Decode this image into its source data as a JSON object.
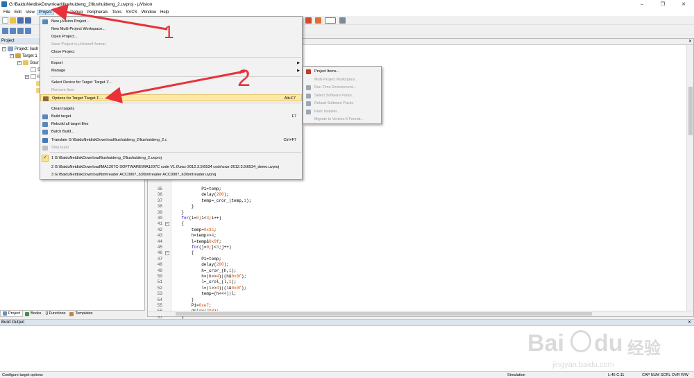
{
  "window": {
    "title": "G:\\BaiduNetdiskDownload\\liushuideng_2\\liushuideng_2.uvproj - µVision",
    "controls": [
      "–",
      "❐",
      "✕"
    ]
  },
  "menubar": [
    "File",
    "Edit",
    "View",
    "Project",
    "Flash",
    "Debug",
    "Peripherals",
    "Tools",
    "SVCS",
    "Window",
    "Help"
  ],
  "project_panel": {
    "title": "Project",
    "tree": [
      "Project: liush",
      "Target 1",
      "Sour",
      "S",
      "li"
    ],
    "tabs": [
      "Project",
      "Books",
      "{} Functions",
      "Templates"
    ]
  },
  "project_menu": {
    "items": [
      {
        "label": "New µVision Project...",
        "shortcut": "",
        "icon": "new-project-icon",
        "disabled": false
      },
      {
        "label": "New Multi-Project Workspace...",
        "shortcut": "",
        "icon": "",
        "disabled": false
      },
      {
        "label": "Open Project...",
        "shortcut": "",
        "icon": "",
        "disabled": false
      },
      {
        "label": "Save Project in µVision4 format",
        "shortcut": "",
        "icon": "",
        "disabled": true
      },
      {
        "label": "Close Project",
        "shortcut": "",
        "icon": "",
        "disabled": false
      },
      {
        "label": "Export",
        "shortcut": "",
        "icon": "",
        "disabled": false,
        "submenu": true
      },
      {
        "label": "Manage",
        "shortcut": "",
        "icon": "",
        "disabled": false,
        "submenu": true
      },
      {
        "label": "Select Device for Target 'Target 1'...",
        "shortcut": "",
        "icon": "",
        "disabled": false
      },
      {
        "label": "Remove Item",
        "shortcut": "",
        "icon": "",
        "disabled": true
      },
      {
        "label": "Options for Target 'Target 1'...",
        "shortcut": "Alt+F7",
        "icon": "options-wand-icon",
        "disabled": false,
        "highlighted": true
      },
      {
        "label": "Clean targets",
        "shortcut": "",
        "icon": "",
        "disabled": false
      },
      {
        "label": "Build target",
        "shortcut": "F7",
        "icon": "build-icon",
        "disabled": false
      },
      {
        "label": "Rebuild all target files",
        "shortcut": "",
        "icon": "rebuild-icon",
        "disabled": false
      },
      {
        "label": "Batch Build...",
        "shortcut": "",
        "icon": "batch-build-icon",
        "disabled": false
      },
      {
        "label": "Translate G:\\BaiduNetdiskDownload\\liushuideng_2\\liushuideng_2.c",
        "shortcut": "Ctrl+F7",
        "icon": "translate-icon",
        "disabled": false
      },
      {
        "label": "Stop build",
        "shortcut": "",
        "icon": "stop-build-icon",
        "disabled": true
      },
      {
        "label": "1 G:\\BaiduNetdiskDownload\\liushuideng_2\\liushuideng_2.uvproj",
        "shortcut": "",
        "icon": "",
        "disabled": false,
        "checked": true
      },
      {
        "label": "2 G:\\BaiduNetdiskDownload\\MA1207C-SOFTWARE\\MA1207C code V1.0\\zwz-2012.3.5\\6534 code\\zwz-2012.3.5\\6534_demo.uvproj",
        "shortcut": "",
        "icon": "",
        "disabled": false
      },
      {
        "label": "3 G:\\BaiduNetdiskDownload\\bmtreader ACC0907_63\\bmtreader ACC0907_63\\bmtreader.uvproj",
        "shortcut": "",
        "icon": "",
        "disabled": false
      }
    ]
  },
  "manage_submenu": [
    {
      "label": "Project Items...",
      "disabled": false,
      "icon": "project-items-icon"
    },
    {
      "label": "Multi-Project Workspace...",
      "disabled": true,
      "icon": ""
    },
    {
      "label": "Run-Time Environment...",
      "disabled": true,
      "icon": "runtime-env-icon"
    },
    {
      "label": "Select Software Packs...",
      "disabled": true,
      "icon": "packs-icon"
    },
    {
      "label": "Reload Software Packs",
      "disabled": true,
      "icon": "reload-icon"
    },
    {
      "label": "Pack Installer...",
      "disabled": true,
      "icon": "pack-installer-icon"
    },
    {
      "label": "Migrate to Version 5 Format...",
      "disabled": true,
      "icon": ""
    }
  ],
  "editor": {
    "lines": [
      {
        "n": "35",
        "fold": false,
        "code": "            P1=temp;"
      },
      {
        "n": "36",
        "fold": false,
        "code": "            delay(200);"
      },
      {
        "n": "37",
        "fold": false,
        "code": "            temp=_cror_(temp,1);"
      },
      {
        "n": "38",
        "fold": false,
        "code": "        }"
      },
      {
        "n": "39",
        "fold": false,
        "code": "    }"
      },
      {
        "n": "40",
        "fold": false,
        "code": "    for(i=0;i<3;i++)"
      },
      {
        "n": "41",
        "fold": true,
        "code": "    {"
      },
      {
        "n": "42",
        "fold": false,
        "code": "        temp=0x3c;"
      },
      {
        "n": "43",
        "fold": false,
        "code": "        h=temp>>4;"
      },
      {
        "n": "44",
        "fold": false,
        "code": "        l=temp&0x0f;"
      },
      {
        "n": "45",
        "fold": false,
        "code": "        for(j=0;j<3;j++)"
      },
      {
        "n": "46",
        "fold": true,
        "code": "        {"
      },
      {
        "n": "47",
        "fold": false,
        "code": "            P1=temp;"
      },
      {
        "n": "48",
        "fold": false,
        "code": "            delay(200);"
      },
      {
        "n": "49",
        "fold": false,
        "code": "            h=_cror_(h,1);"
      },
      {
        "n": "50",
        "fold": false,
        "code": "            h=(h>>4)|(h&0x0f);"
      },
      {
        "n": "51",
        "fold": false,
        "code": "            l=_crol_(l,1);"
      },
      {
        "n": "52",
        "fold": false,
        "code": "            l=(l>>4)|(l&0x0f);"
      },
      {
        "n": "53",
        "fold": false,
        "code": "            temp=(h<<4)|l;"
      },
      {
        "n": "54",
        "fold": false,
        "code": "        }"
      },
      {
        "n": "55",
        "fold": false,
        "code": "        P1=0xe7;"
      },
      {
        "n": "56",
        "fold": false,
        "code": "        delay(200);"
      },
      {
        "n": "57",
        "fold": false,
        "code": "    }"
      }
    ]
  },
  "build_output": {
    "title": "Build Output"
  },
  "statusbar": {
    "message": "Configure target options",
    "mode": "Simulation",
    "position": "L:45 C:11",
    "indicators": "CAP  NUM  SCRL  OVR  R/W"
  },
  "annotations": {
    "label_1": "1",
    "label_2": "2",
    "color": "#e8313a"
  },
  "watermark": {
    "brand": "Bai",
    "brand2": "du",
    "cn": "经验",
    "url": "jingyan.baidu.com"
  },
  "colors": {
    "highlight": "#fde8a4",
    "menu_bg": "#f2f2f2",
    "panel_title": "#dce4ee",
    "keyword": "#0000c8",
    "number": "#d04b00"
  }
}
